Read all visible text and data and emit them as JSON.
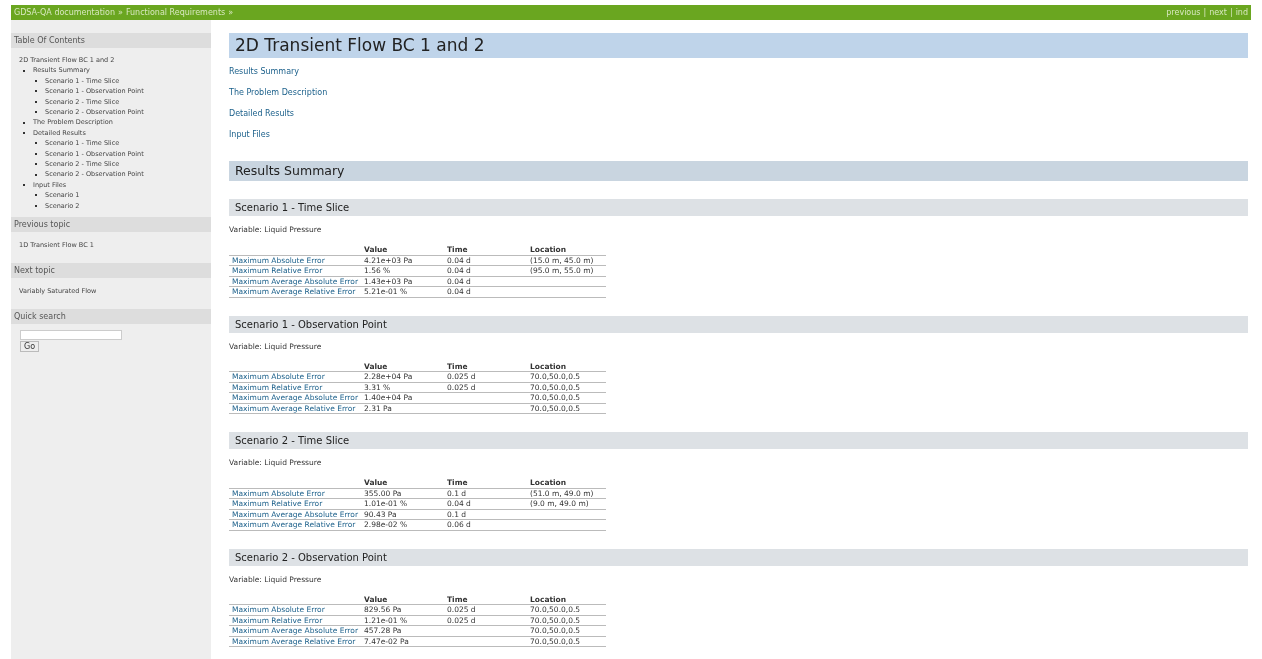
{
  "breadcrumbs": [
    {
      "label": "GDSA-QA documentation",
      "separator": "»"
    },
    {
      "label": "Functional Requirements",
      "separator": "»"
    }
  ],
  "nav": {
    "links": [
      "previous",
      "next",
      "ind"
    ],
    "separator": "|"
  },
  "sidebar": {
    "toc_title": "Table Of Contents",
    "toc": [
      {
        "label": "2D Transient Flow BC 1 and 2",
        "children": [
          {
            "label": "Results Summary",
            "children": [
              {
                "label": "Scenario 1 - Time Slice"
              },
              {
                "label": "Scenario 1 - Observation Point"
              },
              {
                "label": "Scenario 2 - Time Slice"
              },
              {
                "label": "Scenario 2 - Observation Point"
              }
            ]
          },
          {
            "label": "The Problem Description"
          },
          {
            "label": "Detailed Results",
            "children": [
              {
                "label": "Scenario 1 - Time Slice"
              },
              {
                "label": "Scenario 1 - Observation Point"
              },
              {
                "label": "Scenario 2 - Time Slice"
              },
              {
                "label": "Scenario 2 - Observation Point"
              }
            ]
          },
          {
            "label": "Input Files",
            "children": [
              {
                "label": "Scenario 1"
              },
              {
                "label": "Scenario 2"
              }
            ]
          }
        ]
      }
    ],
    "previous_title": "Previous topic",
    "previous_link": "1D Transient Flow BC 1",
    "next_title": "Next topic",
    "next_link": "Variably Saturated Flow",
    "search_title": "Quick search",
    "search_button": "Go"
  },
  "main": {
    "title": "2D Transient Flow BC 1 and 2",
    "links": [
      "Results Summary",
      "The Problem Description",
      "Detailed Results",
      "Input Files"
    ],
    "section_title": "Results Summary",
    "subsections": [
      {
        "title": "Scenario 1 - Time Slice",
        "variable": "Variable: Liquid Pressure",
        "columns": [
          "",
          "Value",
          "Time",
          "Location"
        ],
        "rows": [
          [
            "Maximum Absolute Error",
            "4.21e+03 Pa",
            "0.04 d",
            "(15.0 m, 45.0 m)"
          ],
          [
            "Maximum Relative Error",
            "1.56 %",
            "0.04 d",
            "(95.0 m, 55.0 m)"
          ],
          [
            "Maximum Average Absolute Error",
            "1.43e+03 Pa",
            "0.04 d",
            ""
          ],
          [
            "Maximum Average Relative Error",
            "5.21e-01 %",
            "0.04 d",
            ""
          ]
        ]
      },
      {
        "title": "Scenario 1 - Observation Point",
        "variable": "Variable: Liquid Pressure",
        "columns": [
          "",
          "Value",
          "Time",
          "Location"
        ],
        "rows": [
          [
            "Maximum Absolute Error",
            "2.28e+04 Pa",
            "0.025 d",
            "70.0,50.0,0.5"
          ],
          [
            "Maximum Relative Error",
            "3.31 %",
            "0.025 d",
            "70.0,50.0,0.5"
          ],
          [
            "Maximum Average Absolute Error",
            "1.40e+04 Pa",
            "",
            "70.0,50.0,0.5"
          ],
          [
            "Maximum Average Relative Error",
            "2.31 Pa",
            "",
            "70.0,50.0,0.5"
          ]
        ]
      },
      {
        "title": "Scenario 2 - Time Slice",
        "variable": "Variable: Liquid Pressure",
        "columns": [
          "",
          "Value",
          "Time",
          "Location"
        ],
        "rows": [
          [
            "Maximum Absolute Error",
            "355.00 Pa",
            "0.1 d",
            "(51.0 m, 49.0 m)"
          ],
          [
            "Maximum Relative Error",
            "1.01e-01 %",
            "0.04 d",
            "(9.0 m, 49.0 m)"
          ],
          [
            "Maximum Average Absolute Error",
            "90.43 Pa",
            "0.1 d",
            ""
          ],
          [
            "Maximum Average Relative Error",
            "2.98e-02 %",
            "0.06 d",
            ""
          ]
        ]
      },
      {
        "title": "Scenario 2 - Observation Point",
        "variable": "Variable: Liquid Pressure",
        "columns": [
          "",
          "Value",
          "Time",
          "Location"
        ],
        "rows": [
          [
            "Maximum Absolute Error",
            "829.56 Pa",
            "0.025 d",
            "70.0,50.0,0.5"
          ],
          [
            "Maximum Relative Error",
            "1.21e-01 %",
            "0.025 d",
            "70.0,50.0,0.5"
          ],
          [
            "Maximum Average Absolute Error",
            "457.28 Pa",
            "",
            "70.0,50.0,0.5"
          ],
          [
            "Maximum Average Relative Error",
            "7.47e-02 Pa",
            "",
            "70.0,50.0,0.5"
          ]
        ]
      }
    ]
  }
}
